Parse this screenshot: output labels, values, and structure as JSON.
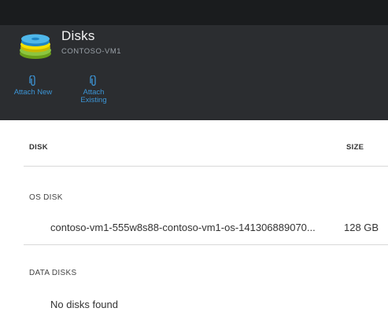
{
  "blade": {
    "title": "Disks",
    "subtitle": "CONTOSO-VM1"
  },
  "commands": {
    "attach_new_label": "Attach New",
    "attach_existing_line1": "Attach",
    "attach_existing_line2": "Existing"
  },
  "table": {
    "columns": {
      "disk": "DISK",
      "size": "SIZE"
    },
    "os_section_label": "OS DISK",
    "os_disk": {
      "name": "contoso-vm1-555w8s88-contoso-vm1-os-141306889070...",
      "size": "128 GB"
    },
    "data_section_label": "DATA DISKS",
    "data_empty_text": "No disks found"
  },
  "icons": {
    "disks": "disks-icon",
    "attach_new": "paperclip-icon",
    "attach_existing": "paperclip-icon"
  },
  "colors": {
    "accent": "#3c95d6",
    "header_bg": "#2b2d30",
    "topbar_bg": "#1a1c1e"
  }
}
